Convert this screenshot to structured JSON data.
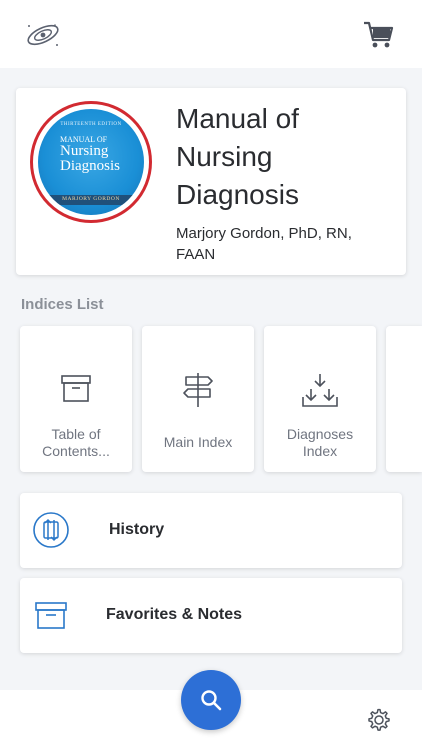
{
  "topbar": {
    "logo_icon": "galaxy-logo-icon",
    "cart_icon": "shopping-cart-icon"
  },
  "book": {
    "title": "Manual of Nursing Diagnosis",
    "author": "Marjory Gordon, PhD, RN, FAAN",
    "cover": {
      "edition": "THIRTEENTH EDITION",
      "line1": "MANUAL OF",
      "line2": "Nursing",
      "line3": "Diagnosis",
      "author": "MARJORY GORDON"
    },
    "ring_color": "#d22a31"
  },
  "indices": {
    "heading": "Indices List",
    "items": [
      {
        "label": "Table of Contents...",
        "icon": "archive-box-icon"
      },
      {
        "label": "Main Index",
        "icon": "signpost-icon"
      },
      {
        "label": "Diagnoses Index",
        "icon": "download-tray-icon"
      }
    ]
  },
  "history": {
    "label": "History",
    "icon": "history-swap-icon"
  },
  "favorites": {
    "label": "Favorites & Notes",
    "icon": "archive-box-icon"
  },
  "bottom": {
    "search_icon": "search-icon",
    "settings_icon": "gear-icon"
  },
  "colors": {
    "accent": "#2d6fd6",
    "icon_blue": "#2a78c9",
    "background": "#f3f5f8"
  }
}
